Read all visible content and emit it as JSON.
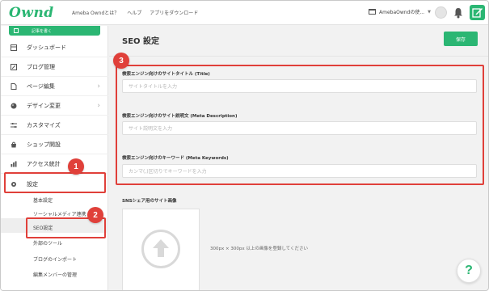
{
  "header": {
    "logo": "Ownd",
    "nav": [
      "Ameba Owndとは？",
      "ヘルプ",
      "アプリをダウンロード"
    ],
    "site_name": "AmebaOwndの使...",
    "edit_icon": "edit-icon"
  },
  "sidebar": {
    "write_label": "記事を書く",
    "items": [
      {
        "label": "ダッシュボード",
        "icon": "dashboard-icon"
      },
      {
        "label": "ブログ管理",
        "icon": "blog-icon"
      },
      {
        "label": "ページ編集",
        "icon": "page-icon"
      },
      {
        "label": "デザイン変更",
        "icon": "palette-icon"
      },
      {
        "label": "カスタマイズ",
        "icon": "sliders-icon"
      },
      {
        "label": "ショップ開設",
        "icon": "shop-icon"
      },
      {
        "label": "アクセス統計",
        "icon": "chart-icon"
      },
      {
        "label": "設定",
        "icon": "gear-icon"
      }
    ],
    "sub_items": [
      "基本設定",
      "ソーシャルメディア連携",
      "SEO設定",
      "外部のツール",
      "ブログのインポート",
      "編集メンバーの管理"
    ]
  },
  "main": {
    "title": "SEO 設定",
    "save_label": "保存",
    "fields": [
      {
        "label": "検索エンジン向けのサイトタイトル (Title)",
        "placeholder": "サイトタイトルを入力"
      },
      {
        "label": "検索エンジン向けのサイト説明文 (Meta Description)",
        "placeholder": "サイト説明文を入力"
      },
      {
        "label": "検索エンジン向けのキーワード (Meta Keywords)",
        "placeholder": "カンマ(,)区切りでキーワードを入力"
      }
    ],
    "sns_label": "SNSシェア用のサイト画像",
    "sns_note": "300px × 300px 以上の画像を登録してください",
    "help": "?"
  },
  "badges": [
    "1",
    "2",
    "3"
  ],
  "colors": {
    "brand_green": "#2bb673",
    "annotation_red": "#e0403a"
  }
}
